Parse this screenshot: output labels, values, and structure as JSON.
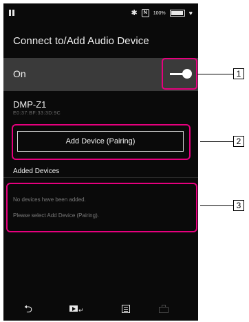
{
  "statusbar": {
    "battery_text": "100%"
  },
  "screen": {
    "title": "Connect to/Add Audio Device",
    "on_label": "On",
    "device_name": "DMP-Z1",
    "device_address": "E0:37:BF:33:3D:9C",
    "pair_button_label": "Add Device (Pairing)",
    "added_devices_label": "Added Devices",
    "empty_line1": "No devices have been added.",
    "empty_line2": "Please select Add Device (Pairing)."
  },
  "callouts": [
    "1",
    "2",
    "3"
  ],
  "icons": {
    "back": "back-icon",
    "now_playing": "now-playing-icon",
    "library": "library-icon",
    "options": "options-icon"
  },
  "colors": {
    "highlight": "#e6007e",
    "screen_bg": "#0a0a0a",
    "row_bg": "#3a3a3a"
  }
}
